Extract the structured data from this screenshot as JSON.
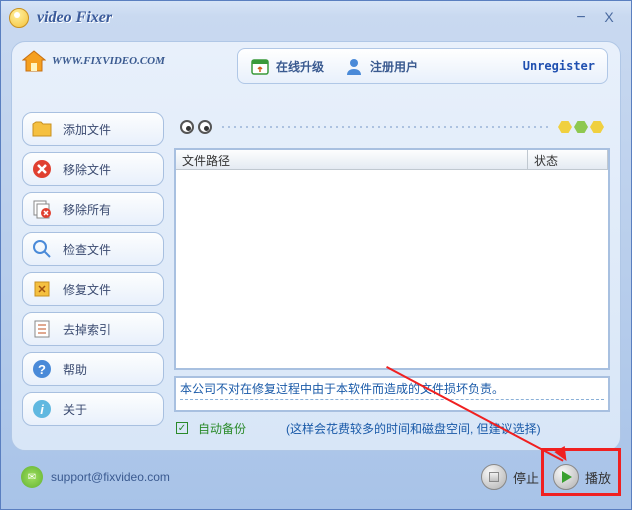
{
  "window": {
    "title": "video Fixer"
  },
  "home": {
    "url": "WWW.FIXVIDEO.COM"
  },
  "topbar": {
    "upgrade": "在线升级",
    "register": "注册用户",
    "unregister": "Unregister"
  },
  "sidebar": {
    "items": [
      {
        "label": "添加文件",
        "icon": "folder-add-icon"
      },
      {
        "label": "移除文件",
        "icon": "remove-icon"
      },
      {
        "label": "移除所有",
        "icon": "remove-all-icon"
      },
      {
        "label": "检查文件",
        "icon": "check-icon"
      },
      {
        "label": "修复文件",
        "icon": "repair-icon"
      },
      {
        "label": "去掉索引",
        "icon": "index-icon"
      },
      {
        "label": "帮助",
        "icon": "help-icon"
      },
      {
        "label": "关于",
        "icon": "about-icon"
      }
    ]
  },
  "list": {
    "col_path": "文件路径",
    "col_status": "状态"
  },
  "message": "本公司不对在修复过程中由于本软件而造成的文件损坏负责。",
  "options": {
    "auto_backup": "自动备份",
    "hint": "(这样会花费较多的时间和磁盘空间, 但建议选择)"
  },
  "footer": {
    "email": "support@fixvideo.com",
    "stop": "停止",
    "play": "播放"
  }
}
